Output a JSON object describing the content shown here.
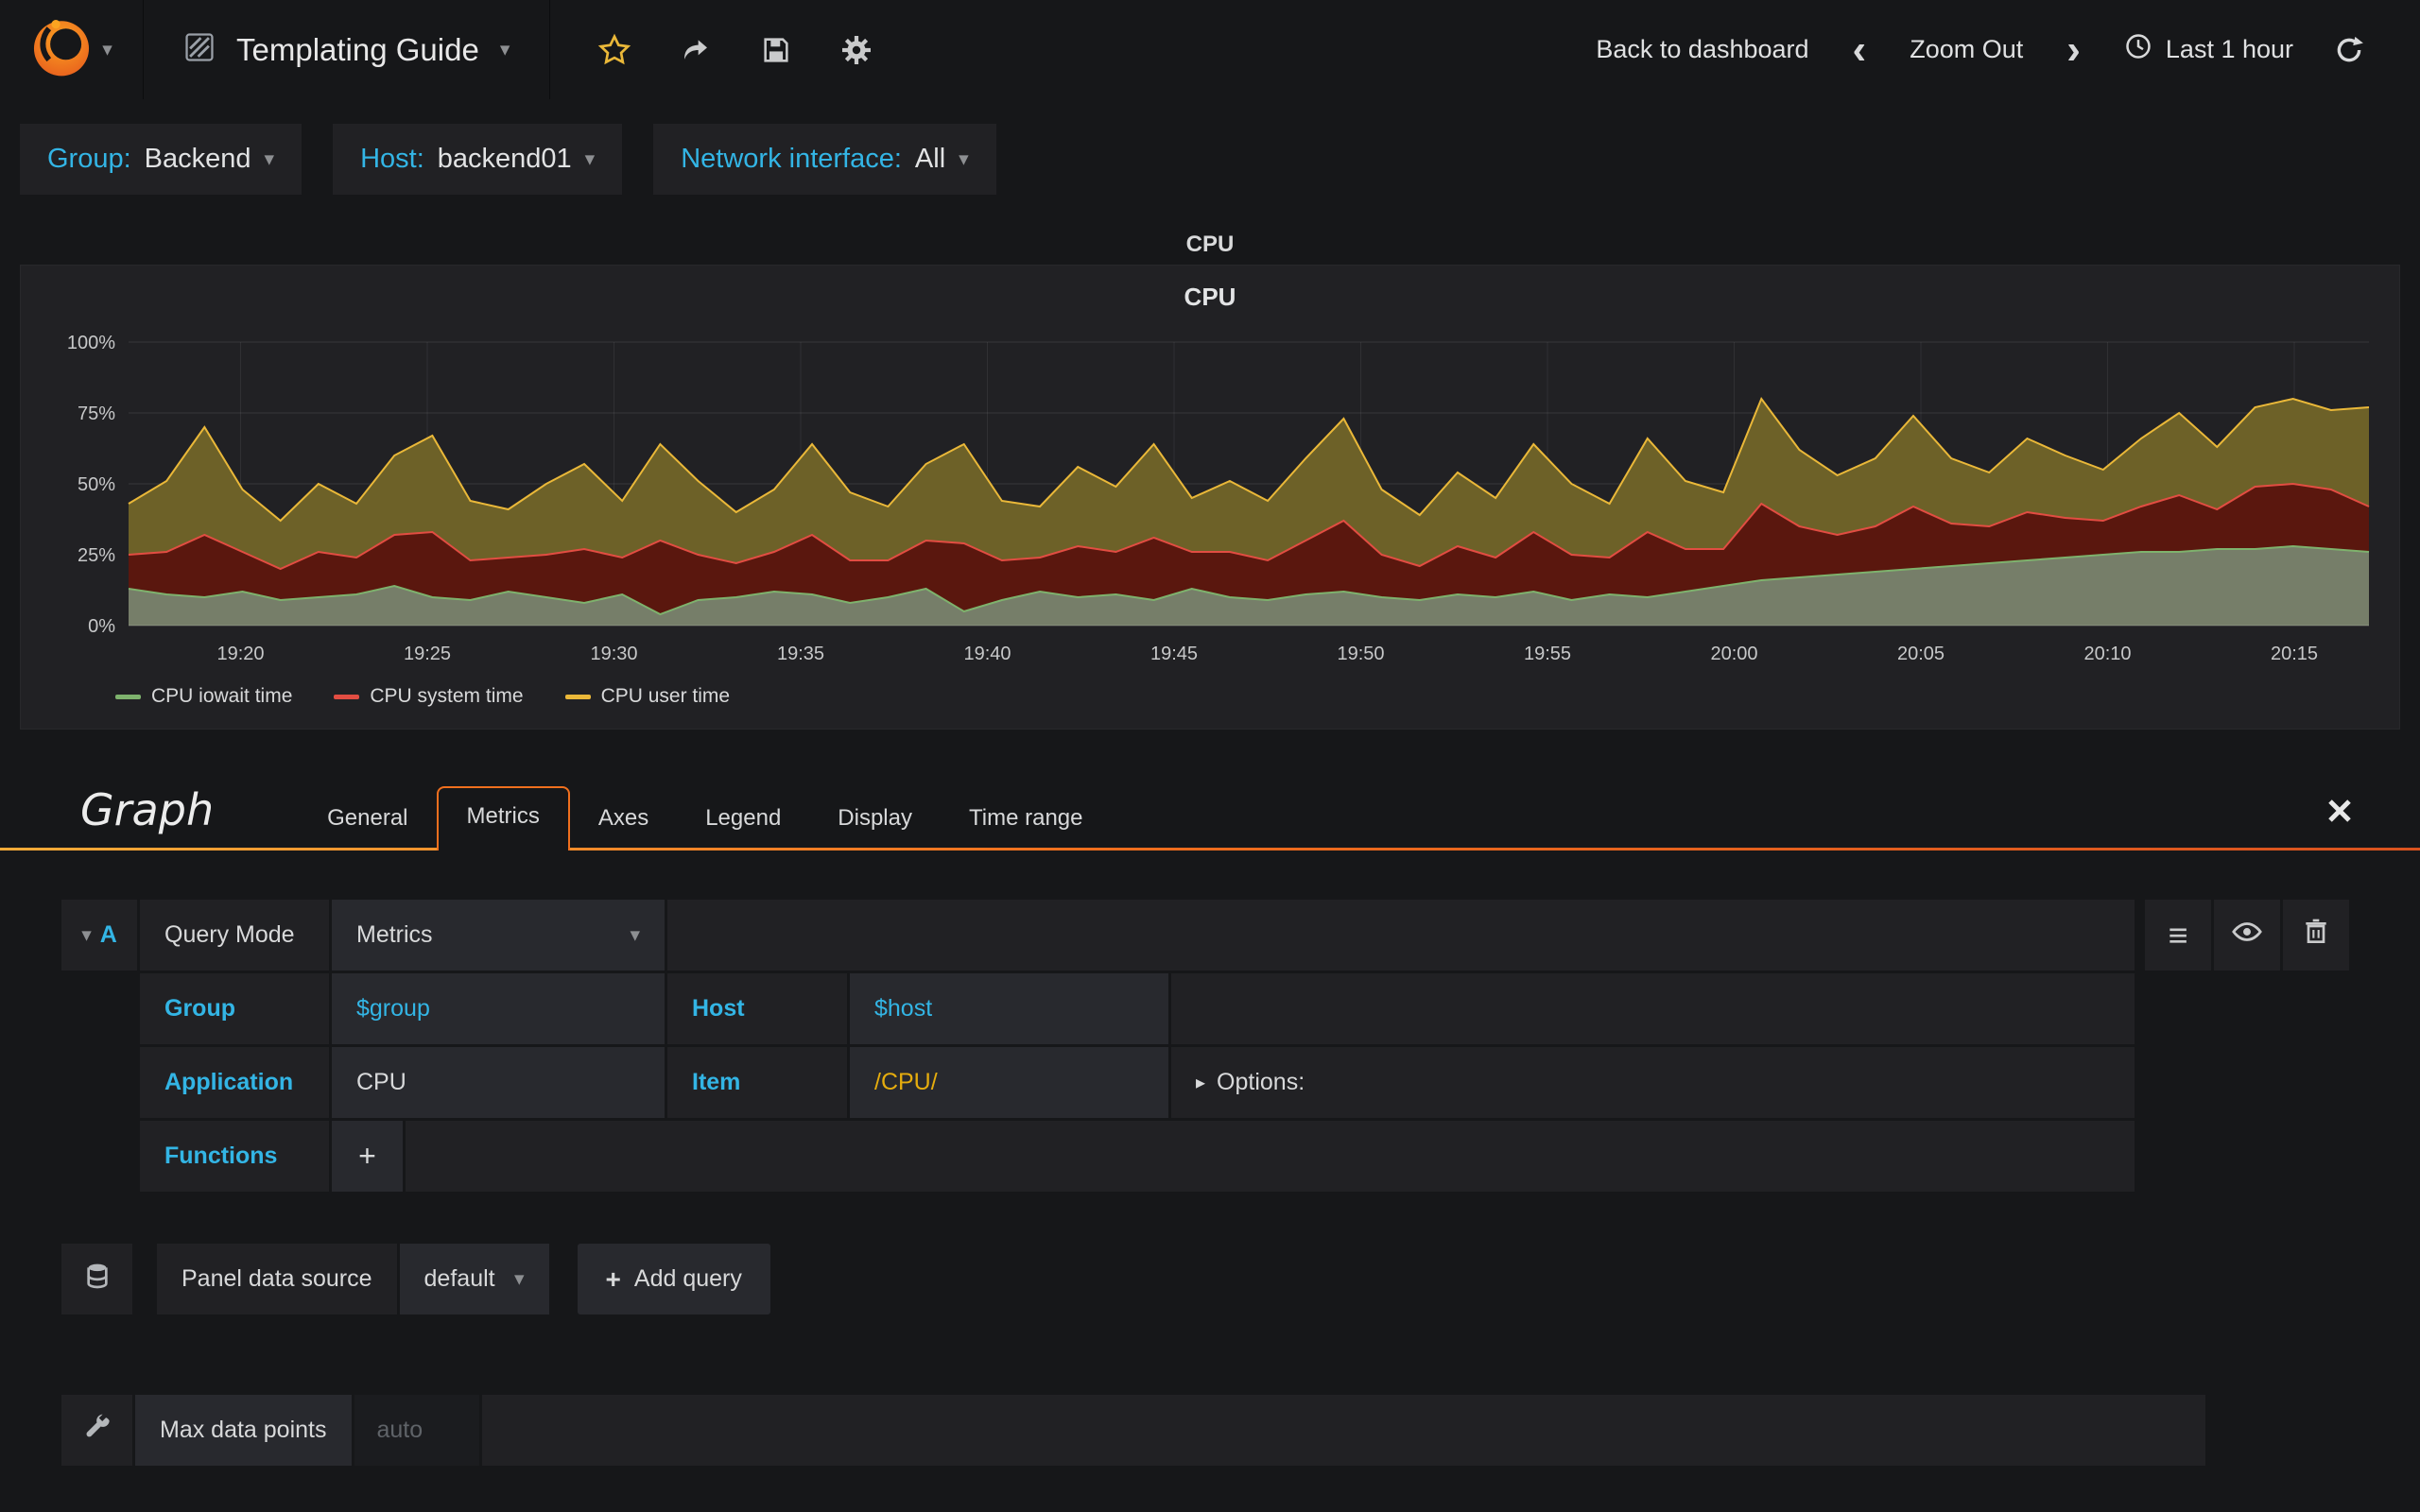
{
  "navbar": {
    "title": "Templating Guide",
    "back_to_dashboard": "Back to dashboard",
    "zoom_out": "Zoom Out",
    "time_range": "Last 1 hour"
  },
  "variables": {
    "group_label": "Group:",
    "group_value": "Backend",
    "host_label": "Host:",
    "host_value": "backend01",
    "network_label": "Network interface:",
    "network_value": "All"
  },
  "panel": {
    "header_title": "CPU",
    "chart_title": "CPU"
  },
  "chart_data": {
    "type": "area",
    "stacked": true,
    "title": "CPU",
    "ylabel": "",
    "xlabel": "",
    "ylim": [
      0,
      100
    ],
    "y_tick_labels": [
      "0%",
      "25%",
      "50%",
      "75%",
      "100%"
    ],
    "x_tick_labels": [
      "19:20",
      "19:25",
      "19:30",
      "19:35",
      "19:40",
      "19:45",
      "19:50",
      "19:55",
      "20:00",
      "20:05",
      "20:10",
      "20:15"
    ],
    "x_range": [
      "19:17",
      "20:17"
    ],
    "grid": true,
    "legend_position": "bottom-left",
    "series": [
      {
        "name": "CPU iowait time",
        "color": "#7eb26d",
        "fill": "#767e69",
        "values": [
          13,
          11,
          10,
          12,
          9,
          10,
          11,
          14,
          10,
          9,
          12,
          10,
          8,
          11,
          4,
          9,
          10,
          12,
          11,
          8,
          10,
          13,
          5,
          9,
          12,
          10,
          11,
          9,
          13,
          10,
          9,
          11,
          12,
          10,
          9,
          11,
          10,
          12,
          9,
          11,
          10,
          12,
          14,
          16,
          17,
          18,
          19,
          20,
          21,
          22,
          23,
          24,
          25,
          26,
          26,
          27,
          27,
          28,
          27,
          26
        ]
      },
      {
        "name": "CPU system time",
        "color": "#e24d42",
        "fill": "#5a170e",
        "values": [
          12,
          15,
          22,
          14,
          11,
          16,
          13,
          18,
          23,
          14,
          12,
          15,
          19,
          13,
          26,
          16,
          12,
          14,
          21,
          15,
          13,
          17,
          24,
          14,
          12,
          18,
          15,
          22,
          13,
          16,
          14,
          19,
          25,
          15,
          12,
          17,
          14,
          21,
          16,
          13,
          23,
          15,
          13,
          27,
          18,
          14,
          16,
          22,
          15,
          13,
          17,
          14,
          12,
          16,
          20,
          14,
          22,
          22,
          21,
          16
        ]
      },
      {
        "name": "CPU user time",
        "color": "#eab839",
        "fill": "#6d6128",
        "values": [
          18,
          25,
          38,
          22,
          17,
          24,
          19,
          28,
          34,
          21,
          17,
          25,
          30,
          20,
          34,
          26,
          18,
          22,
          32,
          24,
          19,
          27,
          35,
          21,
          18,
          28,
          23,
          33,
          19,
          25,
          21,
          29,
          36,
          23,
          18,
          26,
          21,
          31,
          25,
          19,
          33,
          24,
          20,
          37,
          27,
          21,
          24,
          32,
          23,
          19,
          26,
          22,
          18,
          24,
          29,
          22,
          28,
          30,
          28,
          35
        ]
      }
    ]
  },
  "editor": {
    "panel_type": "Graph",
    "tabs": [
      "General",
      "Metrics",
      "Axes",
      "Legend",
      "Display",
      "Time range"
    ],
    "active_tab": "Metrics",
    "query": {
      "ref": "A",
      "query_mode_label": "Query Mode",
      "query_mode_value": "Metrics",
      "group_label": "Group",
      "group_value": "$group",
      "host_label": "Host",
      "host_value": "$host",
      "application_label": "Application",
      "application_value": "CPU",
      "item_label": "Item",
      "item_value": "/CPU/",
      "options_label": "Options:",
      "functions_label": "Functions",
      "add_function_label": "+"
    },
    "datasource": {
      "label": "Panel data source",
      "value": "default",
      "add_query_label": "Add query"
    },
    "max_data_points": {
      "label": "Max data points",
      "placeholder": "auto"
    }
  },
  "colors": {
    "accent_blue": "#33b5e5",
    "accent_yellow": "#e5ac0e",
    "accent_orange": "#ef6f1e",
    "panel_bg": "#212124",
    "page_bg": "#161719"
  }
}
